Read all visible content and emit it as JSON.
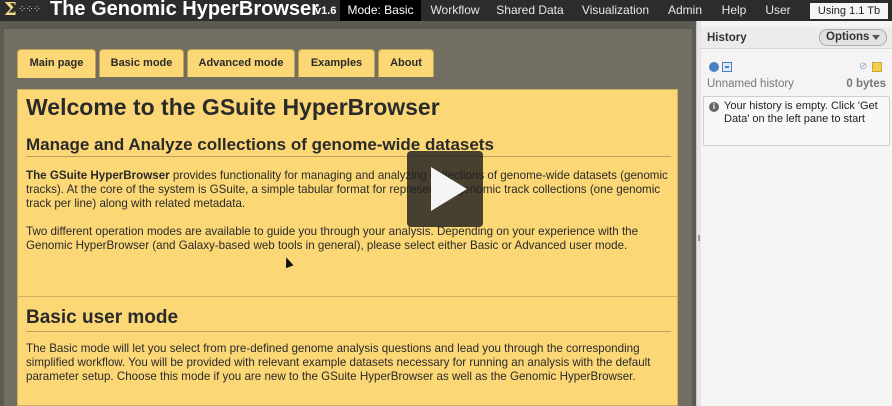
{
  "masthead": {
    "logo_sigma": "Σ",
    "logo_dots": "⁘⁘⁘",
    "title": "The Genomic HyperBrowser",
    "version": "v1.6",
    "nav": [
      {
        "label": "Mode: Basic"
      },
      {
        "label": "Workflow"
      },
      {
        "label": "Shared Data"
      },
      {
        "label": "Visualization"
      },
      {
        "label": "Admin"
      },
      {
        "label": "Help"
      },
      {
        "label": "User"
      }
    ],
    "usage": "Using 1.1 Tb"
  },
  "tabs": [
    {
      "label": "Main page"
    },
    {
      "label": "Basic mode"
    },
    {
      "label": "Advanced mode"
    },
    {
      "label": "Examples"
    },
    {
      "label": "About"
    }
  ],
  "main": {
    "welcome_title": "Welcome to the GSuite HyperBrowser",
    "subtitle": "Manage and Analyze collections of genome-wide datasets",
    "intro_bold": "The GSuite HyperBrowser",
    "intro_rest": " provides functionality for managing and analyzing collections of genome-wide datasets (genomic tracks). At the core of the system is GSuite, a simple tabular format for representing genomic track collections (one genomic track per line) along with related metadata.",
    "modes_para": "Two different operation modes are available to guide you through your analysis. Depending on your experience with the Genomic HyperBrowser (and Galaxy-based web tools in general), please select either Basic or Advanced user mode.",
    "basic_title": "Basic user mode",
    "basic_para": "The Basic mode will let you select from pre-defined genome analysis questions and lead you through the corresponding simplified workflow. You will be provided with relevant example datasets necessary for running an analysis with the default parameter setup. Choose this mode if you are new to the GSuite HyperBrowser as well as the Genomic HyperBrowser."
  },
  "history": {
    "title": "History",
    "options_label": "Options",
    "name": "Unnamed history",
    "size": "0 bytes",
    "empty_message": "Your history is empty. Click 'Get Data' on the left pane to start",
    "info_glyph": "i",
    "tag_glyph": "⊘"
  },
  "colors": {
    "panel": "#fbd776",
    "masthead": "#2c2c2c",
    "active_nav": "#000000",
    "center_bg": "#726e62"
  },
  "icons": [
    "play-icon",
    "refresh-icon",
    "collapse-icon",
    "tag-icon",
    "annotation-icon",
    "info-icon",
    "caret-down-icon"
  ]
}
